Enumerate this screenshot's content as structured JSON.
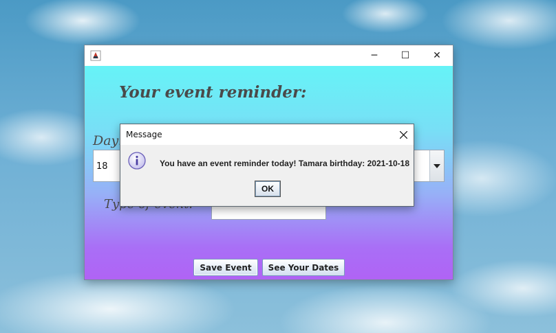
{
  "window": {
    "title": "",
    "icon": "java-cup-icon",
    "controls": {
      "minimize": "─",
      "maximize": "☐",
      "close": "✕"
    }
  },
  "form": {
    "title": "Your event reminder:",
    "day_label": "Day:",
    "day_value": "18",
    "type_label": "Type of event:",
    "type_value": "",
    "save_button": "Save Event",
    "dates_button": "See Your Dates"
  },
  "dialog": {
    "title": "Message",
    "close": "✕",
    "icon": "info-icon",
    "message": "You have an event reminder today! Tamara birthday: 2021-10-18",
    "ok_button": "OK"
  },
  "colors": {
    "gradient_top": "#66f3f7",
    "gradient_bottom": "#b063f5",
    "title_text": "#4a4a4a",
    "dialog_bg": "#f0f0f0"
  }
}
